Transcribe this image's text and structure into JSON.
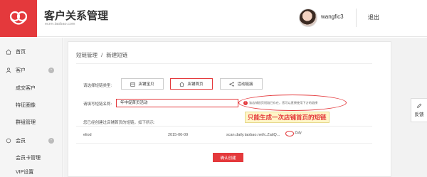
{
  "header": {
    "title": "客户关系管理",
    "subtitle": "ecrm.taobao.com",
    "username": "wangfic3",
    "logout_label": "退出"
  },
  "sidebar": {
    "items": [
      {
        "label": "首页",
        "icon": "home-icon"
      },
      {
        "label": "客户",
        "icon": "user-icon",
        "toggle": "-"
      },
      {
        "label": "成交客户"
      },
      {
        "label": "特征圈像"
      },
      {
        "label": "群组管理"
      },
      {
        "label": "会员",
        "icon": "member-icon",
        "toggle": "-"
      },
      {
        "label": "会员卡管理"
      },
      {
        "label": "VIP设置"
      }
    ]
  },
  "breadcrumb": {
    "parent": "短链管理",
    "separator": "/",
    "current": "新建短链"
  },
  "form": {
    "type_label": "请选择短链类型:",
    "type_options": [
      {
        "label": "店铺宝贝",
        "icon": "calendar-icon"
      },
      {
        "label": "店铺首页",
        "icon": "home-icon",
        "active": true
      },
      {
        "label": "活动链接",
        "icon": "share-icon"
      }
    ],
    "name_label": "请填写短链名称:",
    "name_value": "年中促首页活动",
    "error_text": "该店铺首页短链已存在，您可以直接使用下方的链接",
    "annotation": "只能生成一次店铺首页的短链",
    "generated_text": "您已经创建过店铺首页的短链，如下所示:",
    "row": {
      "name": "eliod",
      "date": "2015-06-09",
      "url": "scan.daily.taobao.net/c.ZatiQ...",
      "copy_label": "Zaty"
    },
    "confirm_label": "确认创建"
  },
  "feedback": {
    "label": "反馈"
  },
  "colors": {
    "accent": "#e4393c",
    "annotation_bg": "#fff6c8"
  }
}
